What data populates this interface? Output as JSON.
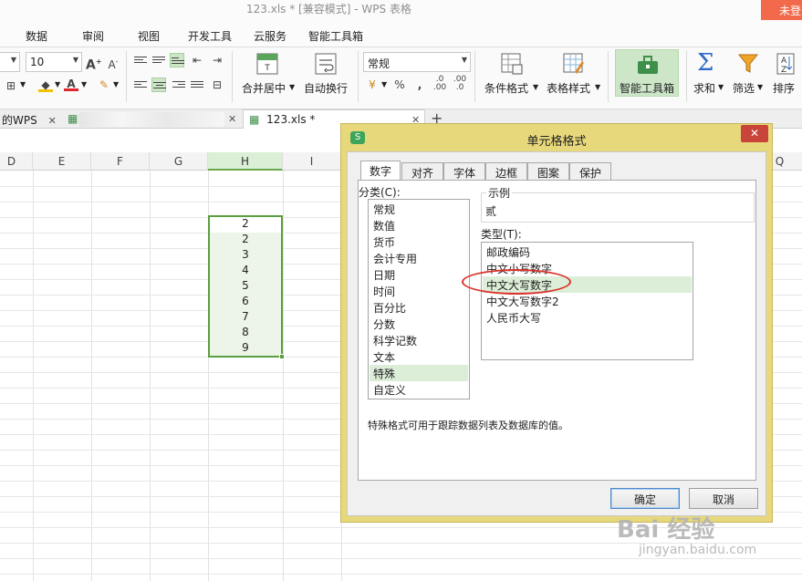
{
  "window": {
    "title": "123.xls * [兼容模式] - WPS 表格",
    "login_label": "未登"
  },
  "menu": {
    "tabs": [
      "数据",
      "审阅",
      "视图",
      "开发工具",
      "云服务",
      "智能工具箱"
    ]
  },
  "ribbon": {
    "font_size": "10",
    "number_format": "常规",
    "merge_label": "合并居中",
    "wrap_label": "自动换行",
    "cond_format_label": "条件格式",
    "table_style_label": "表格样式",
    "smart_toolbox_label": "智能工具箱",
    "sum_label": "求和",
    "filter_label": "筛选",
    "sort_label": "排序",
    "percent_symbol": "%",
    "grow_font": "A",
    "shrink_font": "A"
  },
  "doc_tabs": {
    "tab1_label": "的WPS",
    "tab3_label": "123.xls *",
    "add_tab": "+"
  },
  "sheet": {
    "columns": [
      "D",
      "E",
      "F",
      "G",
      "H",
      "I",
      "Q"
    ],
    "selected_column": "H",
    "cells": [
      "2",
      "2",
      "3",
      "4",
      "5",
      "6",
      "7",
      "8",
      "9"
    ]
  },
  "dialog": {
    "title": "单元格格式",
    "close_symbol": "✕",
    "tabs": [
      "数字",
      "对齐",
      "字体",
      "边框",
      "图案",
      "保护"
    ],
    "category_label": "分类(C):",
    "categories": [
      "常规",
      "数值",
      "货币",
      "会计专用",
      "日期",
      "时间",
      "百分比",
      "分数",
      "科学记数",
      "文本",
      "特殊",
      "自定义"
    ],
    "selected_category": "特殊",
    "sample_label": "示例",
    "sample_value": "贰",
    "type_label": "类型(T):",
    "types": [
      "邮政编码",
      "中文小写数字",
      "中文大写数字",
      "中文大写数字2",
      "人民币大写"
    ],
    "selected_type": "中文大写数字",
    "description": "特殊格式可用于跟踪数据列表及数据库的值。",
    "ok_label": "确定",
    "cancel_label": "取消"
  },
  "colors": {
    "accent_green": "#5a9e3f",
    "dialog_frame": "#e7d87c",
    "close_red": "#c9453a",
    "annotation_red": "#d9312b"
  },
  "watermark": {
    "text": "Bai 经验",
    "url": "jingyan.baidu.com"
  }
}
